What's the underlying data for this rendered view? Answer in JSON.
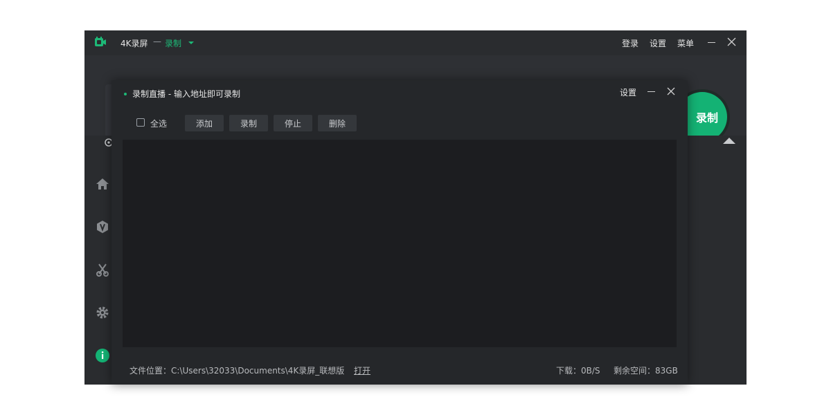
{
  "app": {
    "title": "4K录屏",
    "separator": "—",
    "mode": "录制",
    "login": "登录",
    "settings": "设置",
    "menu": "菜单",
    "record_button": "录制",
    "accent_color": "#14b274"
  },
  "dialog": {
    "title": "录制直播 - 输入地址即可录制",
    "settings": "设置",
    "select_all": "全选",
    "buttons": [
      "添加",
      "录制",
      "停止",
      "删除"
    ],
    "file_location_label": "文件位置：",
    "file_location_value": "C:\\Users\\32033\\Documents\\4K录屏_联想版",
    "open_link": "打开",
    "download_label": "下载：",
    "download_value": "0B/S",
    "space_label": "剩余空间：",
    "space_value": "83GB"
  },
  "sidebar": {
    "icons": [
      "home-icon",
      "vip-icon",
      "scissors-icon",
      "gear-icon",
      "info-icon"
    ]
  }
}
